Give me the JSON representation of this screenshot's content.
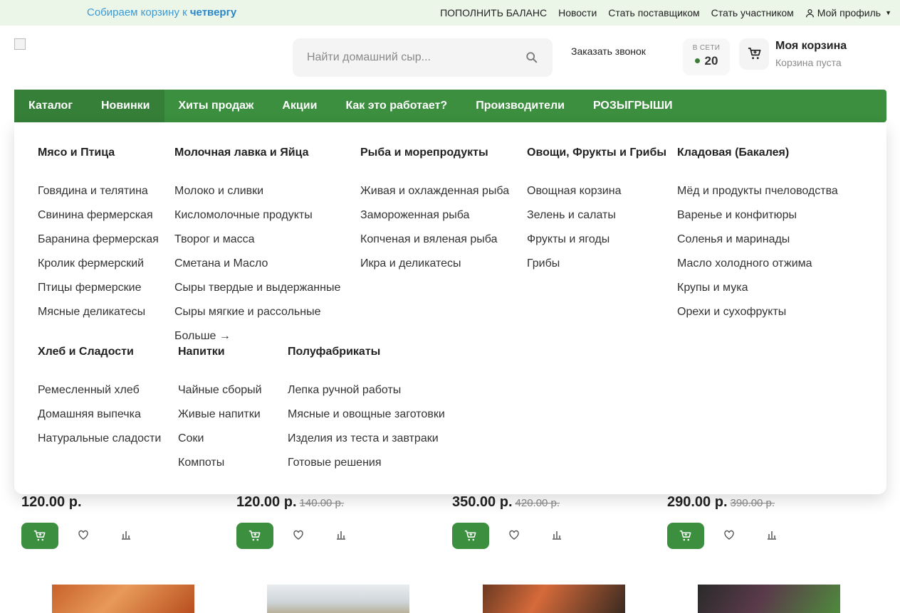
{
  "topbar": {
    "promo_prefix": "Собираем корзину к",
    "promo_day": "четвергу",
    "links": [
      "ПОПОЛНИТЬ БАЛАНС",
      "Новости",
      "Стать поставщиком",
      "Стать участником"
    ],
    "profile": "Мой профиль"
  },
  "header": {
    "search_placeholder": "Найти домашний сыр...",
    "callback": "Заказать звонок",
    "online_label": "В СЕТИ",
    "online_count": "20",
    "cart_title": "Моя корзина",
    "cart_status": "Корзина пуста"
  },
  "nav": [
    "Каталог",
    "Новинки",
    "Хиты продаж",
    "Акции",
    "Как это работает?",
    "Производители",
    "РОЗЫГРЫШИ"
  ],
  "menu": {
    "cols": [
      {
        "title": "Мясо и Птица",
        "items": [
          "Говядина и телятина",
          "Свинина фермерская",
          "Баранина фермерская",
          "Кролик фермерский",
          "Птицы фермерские",
          "Мясные деликатесы"
        ]
      },
      {
        "title": "Молочная лавка и Яйца",
        "items": [
          "Молоко и сливки",
          "Кисломолочные продукты",
          "Творог и масса",
          "Сметана и Масло",
          "Сыры твердые и выдержанные",
          "Сыры мягкие и рассольные",
          "Больше →"
        ]
      },
      {
        "title": "Рыба и морепродукты",
        "items": [
          "Живая и охлажденная рыба",
          "Замороженная рыба",
          "Копченая и вяленая рыба",
          "Икра и деликатесы"
        ]
      },
      {
        "title": "Овощи, Фрукты и Грибы",
        "items": [
          "Овощная корзина",
          "Зелень и салаты",
          "Фрукты и ягоды",
          "Грибы"
        ]
      },
      {
        "title": "Кладовая (Бакалея)",
        "items": [
          "Мёд и продукты пчеловодства",
          "Варенье и конфитюры",
          "Соленья и маринады",
          "Масло холодного отжима",
          "Крупы и мука",
          "Орехи и сухофрукты"
        ]
      },
      {
        "title": "Хлеб и Сладости",
        "items": [
          "Ремесленный хлеб",
          "Домашняя выпечка",
          "Натуральные сладости"
        ]
      },
      {
        "title": "Напитки",
        "items": [
          "Чайные сборый",
          "Живые напитки",
          "Соки",
          "Компоты"
        ]
      },
      {
        "title": "Полуфабрикаты",
        "items": [
          "Лепка ручной работы",
          "Мясные и овощные заготовки",
          "Изделия из теста и завтраки",
          "Готовые решения"
        ]
      }
    ]
  },
  "products": [
    {
      "price": "120.00 р.",
      "old": ""
    },
    {
      "price": "120.00 р.",
      "old": "140.00 р."
    },
    {
      "price": "350.00 р.",
      "old": "420.00 р."
    },
    {
      "price": "290.00 р.",
      "old": "390.00 р."
    }
  ],
  "colors": {
    "brand_green": "#3b8f3e",
    "promo_blue": "#3a9ad9",
    "topbar_bg": "#ebf6e8"
  }
}
